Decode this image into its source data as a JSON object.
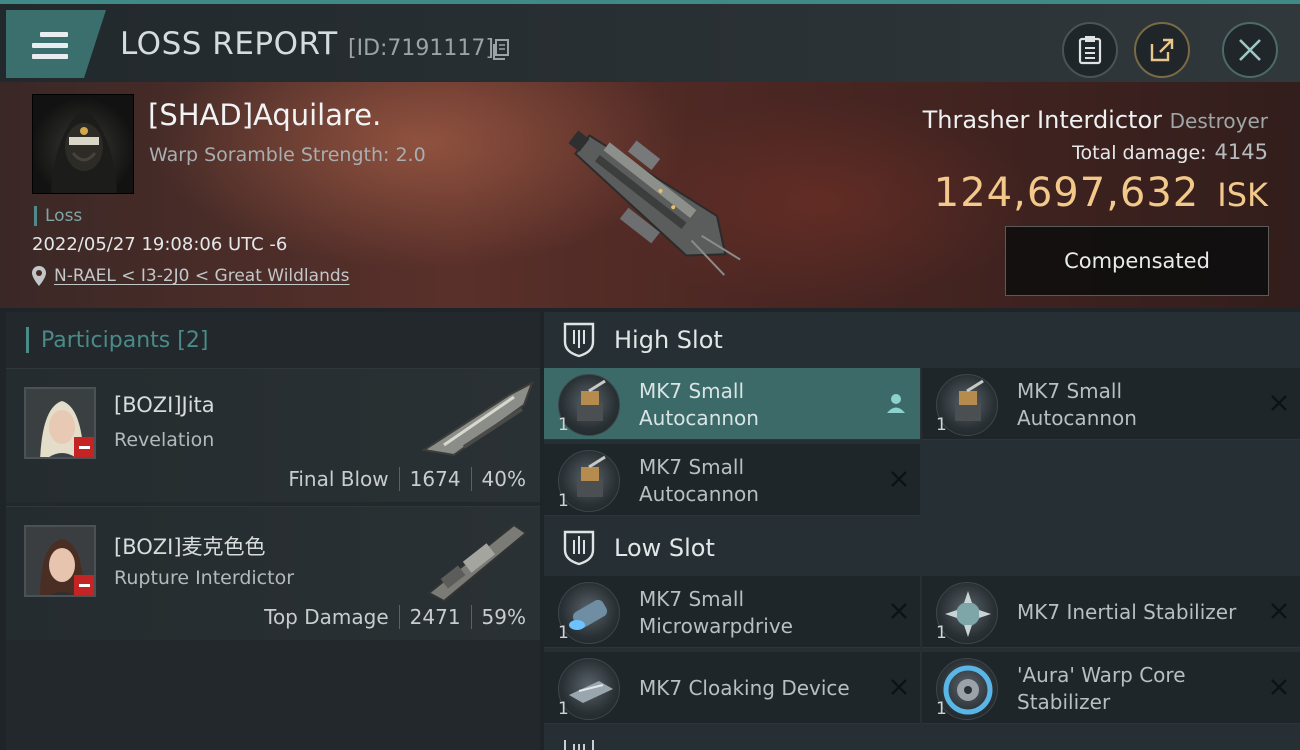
{
  "header": {
    "title": "LOSS REPORT",
    "report_id": "[ID:7191117]",
    "menu_icon": "hamburger-menu-icon",
    "buttons": [
      "clipboard-icon",
      "share-icon",
      "close-icon"
    ]
  },
  "victim": {
    "name": "[SHAD]Aquilare.",
    "warp_scramble": "Warp Soramble Strength: 2.0",
    "status": "Loss",
    "timestamp": "2022/05/27 19:08:06 UTC -6",
    "location": "N-RAEL < I3-2J0 < Great Wildlands"
  },
  "ship": {
    "name": "Thrasher Interdictor",
    "class": "Destroyer",
    "total_damage_label": "Total damage:",
    "total_damage": "4145",
    "value": "124,697,632",
    "currency": "ISK",
    "compensated_label": "Compensated"
  },
  "participants": {
    "label": "Participants",
    "count": "[2]",
    "items": [
      {
        "name": "[BOZI]Jita",
        "ship": "Revelation",
        "role": "Final Blow",
        "damage": "1674",
        "percent": "40%"
      },
      {
        "name": "[BOZI]麦克色色",
        "ship": "Rupture Interdictor",
        "role": "Top Damage",
        "damage": "2471",
        "percent": "59%"
      }
    ]
  },
  "fittings": {
    "high_slot": {
      "label": "High Slot",
      "modules": [
        {
          "name": "MK7 Small Autocannon",
          "qty": "1",
          "state": "active"
        },
        {
          "name": "MK7 Small Autocannon",
          "qty": "1",
          "state": "destroyed"
        },
        {
          "name": "MK7 Small Autocannon",
          "qty": "1",
          "state": "destroyed"
        }
      ]
    },
    "low_slot": {
      "label": "Low Slot",
      "modules": [
        {
          "name": "MK7 Small Microwarpdrive",
          "qty": "1",
          "state": "destroyed"
        },
        {
          "name": "MK7 Inertial Stabilizer",
          "qty": "1",
          "state": "destroyed"
        },
        {
          "name": "MK7 Cloaking Device",
          "qty": "1",
          "state": "destroyed"
        },
        {
          "name": "'Aura' Warp Core Stabilizer",
          "qty": "1",
          "state": "destroyed"
        }
      ]
    }
  },
  "colors": {
    "accent": "#3f8a86",
    "isk": "#f2c98a",
    "active_module": "#3c6a69",
    "badge": "#c42424"
  }
}
